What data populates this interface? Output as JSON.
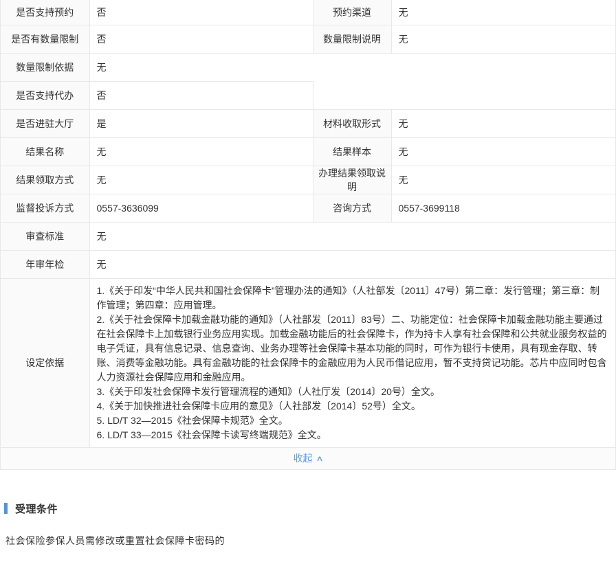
{
  "colors": {
    "accent_blue": "#5b9bf0",
    "section_bar_blue": "#4d96e0",
    "label_bg": "#fafafa",
    "border": "#e8e8e8",
    "text": "#333333"
  },
  "table": {
    "r1": {
      "l1": "是否支持预约",
      "v1": "否",
      "l2": "预约渠道",
      "v2": "无"
    },
    "r2": {
      "l1": "是否有数量限制",
      "v1": "否",
      "l2": "数量限制说明",
      "v2": "无"
    },
    "r3": {
      "l": "数量限制依据",
      "v": "无"
    },
    "r4": {
      "l": "是否支持代办",
      "v": "否"
    },
    "r5": {
      "l1": "是否进驻大厅",
      "v1": "是",
      "l2": "材料收取形式",
      "v2": "无"
    },
    "r6": {
      "l1": "结果名称",
      "v1": "无",
      "l2": "结果样本",
      "v2": "无"
    },
    "r7": {
      "l1": "结果领取方式",
      "v1": "无",
      "l2": "办理结果领取说明",
      "v2": "无"
    },
    "r8": {
      "l1": "监督投诉方式",
      "v1": "0557-3636099",
      "l2": "咨询方式",
      "v2": "0557-3699118"
    },
    "r9": {
      "l": "审查标准",
      "v": "无"
    },
    "r10": {
      "l": "年审年检",
      "v": "无"
    },
    "r11": {
      "l": "设定依据",
      "items": [
        "1.《关于印发“中华人民共和国社会保障卡”管理办法的通知》（人社部发〔2011〕47号）第二章：发行管理；第三章：制作管理；第四章：应用管理。",
        "2.《关于社会保障卡加载金融功能的通知》（人社部发〔2011〕83号）二、功能定位：社会保障卡加载金融功能主要通过在社会保障卡上加载银行业务应用实现。加载金融功能后的社会保障卡，作为持卡人享有社会保障和公共就业服务权益的电子凭证，具有信息记录、信息查询、业务办理等社会保障卡基本功能的同时，可作为银行卡使用，具有现金存取、转账、消费等金融功能。具有金融功能的社会保障卡的金融应用为人民币借记应用，暂不支持贷记功能。芯片中应同时包含人力资源社会保障应用和金融应用。",
        "3.《关于印发社会保障卡发行管理流程的通知》（人社厅发〔2014〕20号）全文。",
        "4.《关于加快推进社会保障卡应用的意见》（人社部发〔2014〕52号）全文。",
        "5. LD/T 32—2015《社会保障卡规范》全文。",
        "6. LD/T 33—2015《社会保障卡读写终端规范》全文。"
      ]
    }
  },
  "collapse": {
    "label": "收起",
    "icon": "∧"
  },
  "section": {
    "title": "受理条件",
    "body": "社会保险参保人员需修改或重置社会保障卡密码的"
  }
}
